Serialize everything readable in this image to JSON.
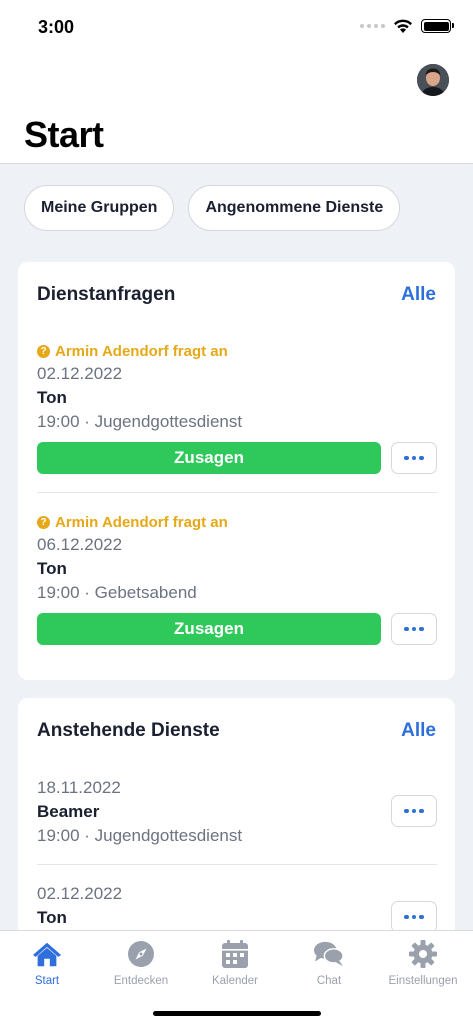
{
  "status": {
    "time": "3:00"
  },
  "header": {
    "title": "Start"
  },
  "chips": [
    "Meine Gruppen",
    "Angenommene Dienste"
  ],
  "requests": {
    "title": "Dienstanfragen",
    "all_label": "Alle",
    "items": [
      {
        "requester": "Armin Adendorf fragt an",
        "date": "02.12.2022",
        "role": "Ton",
        "meta": "19:00 · Jugendgottesdienst",
        "accept_label": "Zusagen"
      },
      {
        "requester": "Armin Adendorf fragt an",
        "date": "06.12.2022",
        "role": "Ton",
        "meta": "19:00 · Gebetsabend",
        "accept_label": "Zusagen"
      }
    ]
  },
  "upcoming": {
    "title": "Anstehende Dienste",
    "all_label": "Alle",
    "items": [
      {
        "date": "18.11.2022",
        "role": "Beamer",
        "meta": "19:00 · Jugendgottesdienst"
      },
      {
        "date": "02.12.2022",
        "role": "Ton",
        "meta": ""
      }
    ]
  },
  "tabs": [
    {
      "label": "Start",
      "icon": "home-icon",
      "active": true
    },
    {
      "label": "Entdecken",
      "icon": "compass-icon",
      "active": false
    },
    {
      "label": "Kalender",
      "icon": "calendar-icon",
      "active": false
    },
    {
      "label": "Chat",
      "icon": "chat-icon",
      "active": false
    },
    {
      "label": "Einstellungen",
      "icon": "gear-icon",
      "active": false
    }
  ],
  "colors": {
    "accent": "#2f6fdb",
    "success": "#2fc85b",
    "warning": "#e6a817",
    "inactive": "#9aa1ad"
  }
}
